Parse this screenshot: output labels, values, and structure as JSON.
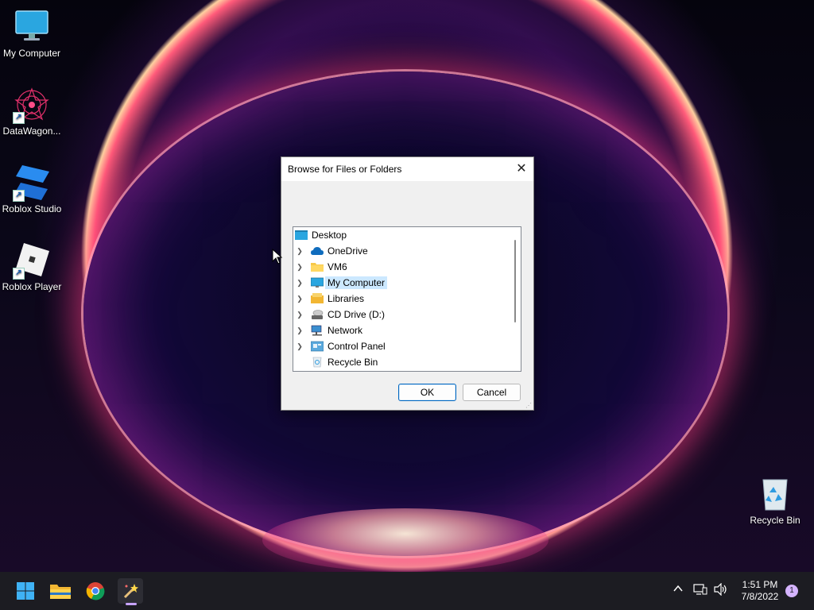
{
  "desktop": {
    "icons": [
      {
        "label": "My Computer",
        "icon": "monitor-icon"
      },
      {
        "label": "DataWagon...",
        "icon": "datawagon-icon"
      },
      {
        "label": "Roblox Studio",
        "icon": "roblox-studio-icon"
      },
      {
        "label": "Roblox Player",
        "icon": "roblox-player-icon"
      },
      {
        "label": "Recycle Bin",
        "icon": "recycle-bin-icon"
      }
    ]
  },
  "dialog": {
    "title": "Browse for Files or Folders",
    "close_symbol": "✕",
    "tree": [
      {
        "label": "Desktop",
        "icon": "desktop-icon",
        "expandable": false
      },
      {
        "label": "OneDrive",
        "icon": "onedrive-cloud-icon",
        "expandable": true
      },
      {
        "label": "VM6",
        "icon": "folder-icon",
        "expandable": true
      },
      {
        "label": "My Computer",
        "icon": "monitor-icon",
        "expandable": true,
        "selected": true
      },
      {
        "label": "Libraries",
        "icon": "libraries-icon",
        "expandable": true
      },
      {
        "label": "CD Drive (D:)",
        "icon": "cd-drive-icon",
        "expandable": true
      },
      {
        "label": "Network",
        "icon": "network-icon",
        "expandable": true
      },
      {
        "label": "Control Panel",
        "icon": "control-panel-icon",
        "expandable": true
      },
      {
        "label": "Recycle Bin",
        "icon": "recycle-bin-icon",
        "expandable": false
      }
    ],
    "ok_label": "OK",
    "cancel_label": "Cancel"
  },
  "taskbar": {
    "apps": [
      "windows-start-icon",
      "file-explorer-icon",
      "chrome-icon",
      "magic-wand-app-icon"
    ],
    "tray": [
      "chevron-up-icon",
      "network-icon",
      "volume-icon"
    ],
    "time": "1:51 PM",
    "date": "7/8/2022",
    "notification_count": "1"
  },
  "colors": {
    "selection": "#cce8ff",
    "accent": "#0067c0",
    "taskbar": "#1c1c22"
  }
}
